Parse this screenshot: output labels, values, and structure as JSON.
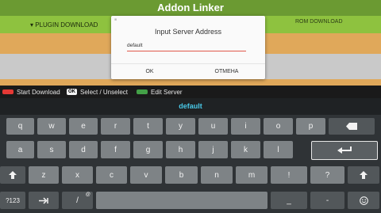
{
  "app": {
    "title": "Addon Linker"
  },
  "tabs": {
    "left": "▾ PLUGIN DOWNLOAD",
    "right": "ROM DOWNLOAD"
  },
  "legend": {
    "start": "Start Download",
    "ok_key": "OK",
    "select": "Select / Unselect",
    "edit": "Edit Server"
  },
  "colors": {
    "header": "#6b9a32",
    "tab_green": "#8ec23f",
    "orange_band": "#e0a85a",
    "accent": "#49c9e8"
  },
  "dialog": {
    "title": "Input Server Address",
    "input_value": "default",
    "ok": "OK",
    "cancel": "ОТМЕНА"
  },
  "keyboard": {
    "input_text": "default",
    "row1": [
      "q",
      "w",
      "e",
      "r",
      "t",
      "y",
      "u",
      "i",
      "o",
      "p"
    ],
    "row2": [
      "a",
      "s",
      "d",
      "f",
      "g",
      "h",
      "j",
      "k",
      "l"
    ],
    "row3": [
      "z",
      "x",
      "c",
      "v",
      "b",
      "n",
      "m",
      "!",
      "?"
    ],
    "row4": {
      "symbols": "?123",
      "slash": "/",
      "at": "@",
      "underscore": "_",
      "dash": "-"
    },
    "icons": [
      "backspace-icon",
      "enter-icon",
      "shift-icon",
      "tab-icon",
      "emoji-icon"
    ]
  }
}
